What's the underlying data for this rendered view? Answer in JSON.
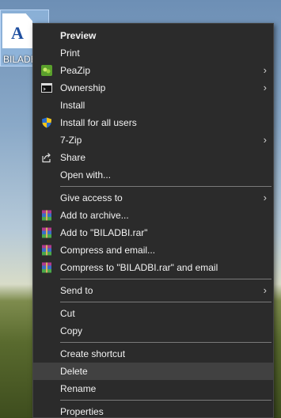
{
  "desktop": {
    "file_label": "BILADB",
    "file_glyph": "A"
  },
  "menu": {
    "preview": "Preview",
    "print": "Print",
    "peazip": "PeaZip",
    "ownership": "Ownership",
    "install": "Install",
    "install_all": "Install for all users",
    "sevenzip": "7-Zip",
    "share": "Share",
    "open_with": "Open with...",
    "give_access": "Give access to",
    "add_archive": "Add to archive...",
    "add_rar": "Add to \"BILADBI.rar\"",
    "compress_email": "Compress and email...",
    "compress_rar_email": "Compress to \"BILADBI.rar\" and email",
    "send_to": "Send to",
    "cut": "Cut",
    "copy": "Copy",
    "create_shortcut": "Create shortcut",
    "delete": "Delete",
    "rename": "Rename",
    "properties": "Properties",
    "submenu_arrow": "›"
  },
  "colors": {
    "menu_bg": "#2b2b2b",
    "selected_bg": "#414141",
    "text": "#f2f2f2"
  }
}
